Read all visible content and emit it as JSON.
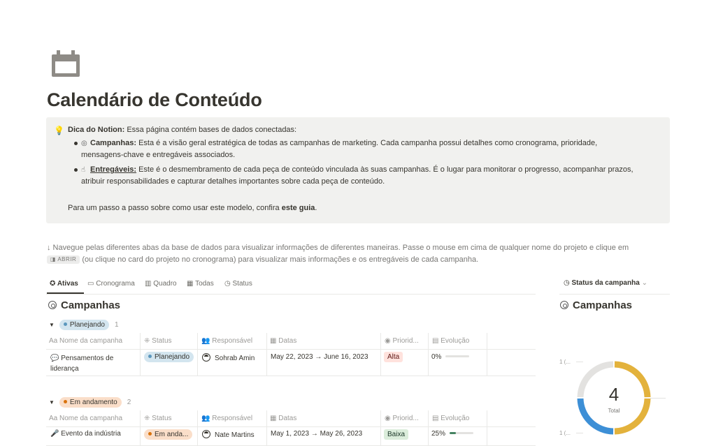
{
  "page": {
    "icon": "calendar-icon",
    "title": "Calendário de Conteúdo"
  },
  "callout": {
    "icon": "lightbulb-icon",
    "lead_bold": "Dica do Notion:",
    "lead_text": " Essa página contém bases de dados conectadas:",
    "items": [
      {
        "icon": "target-icon",
        "label": "Campanhas:",
        "line1": " Esta é a visão geral estratégica de todas as campanhas de marketing. Cada campanha possui detalhes como cronograma, prioridade,",
        "line2": "mensagens-chave e entregáveis associados."
      },
      {
        "icon": "hand-icon",
        "label": "Entregáveis:",
        "line1": " Este é o desmembramento de cada peça de conteúdo vinculada às suas campanhas. É o lugar para monitorar o progresso, acompanhar prazos,",
        "line2": "atribuir responsabilidades e capturar detalhes importantes sobre cada peça de conteúdo."
      }
    ],
    "guide_prefix": "Para um passo a passo sobre como usar este modelo, confira ",
    "guide_link": "este guia",
    "guide_suffix": "."
  },
  "instructions": {
    "line1": "↓ Navegue pelas diferentes abas da base de dados para visualizar informações de diferentes maneiras. Passe o mouse em cima de qualquer nome do projeto e clique em",
    "open_badge": "◨ ABRIR",
    "line2_rest": " (ou clique no card do projeto no cronograma) para visualizar mais informações e os entregáveis de cada campanha."
  },
  "tabs": [
    {
      "icon": "star-icon",
      "glyph": "✪",
      "label": "Ativas",
      "active": true
    },
    {
      "icon": "timeline-icon",
      "glyph": "▭",
      "label": "Cronograma",
      "active": false
    },
    {
      "icon": "board-icon",
      "glyph": "▥",
      "label": "Quadro",
      "active": false
    },
    {
      "icon": "table-icon",
      "glyph": "▦",
      "label": "Todas",
      "active": false
    },
    {
      "icon": "clock-icon",
      "glyph": "◷",
      "label": "Status",
      "active": false
    }
  ],
  "main_section_title": "Campanhas",
  "columns": [
    {
      "icon": "Aa",
      "label": "Nome da campanha"
    },
    {
      "icon": "⁜",
      "label": "Status"
    },
    {
      "icon": "👥",
      "label": "Responsável"
    },
    {
      "icon": "▦",
      "label": "Datas"
    },
    {
      "icon": "◉",
      "label": "Priorid..."
    },
    {
      "icon": "▤",
      "label": "Evolução"
    }
  ],
  "groups": [
    {
      "label": "Planejando",
      "count": "1",
      "rows": [
        {
          "icon": "speech-bubble-icon",
          "glyph": "💬",
          "name_line1": "Pensamentos de",
          "name_line2": "liderança",
          "status": "Planejando",
          "owner": "Sohrab Amin",
          "dates": "May 22, 2023 → June 16, 2023",
          "priority": "Alta",
          "progress_label": "0%",
          "progress": 0
        }
      ]
    },
    {
      "label": "Em andamento",
      "count": "2",
      "rows": [
        {
          "icon": "microphone-icon",
          "glyph": "🎤",
          "name_line1": "Evento da indústria",
          "name_line2": "",
          "status": "Em anda...",
          "owner": "Nate Martins",
          "dates": "May 1, 2023 → May 26, 2023",
          "priority": "Baixa",
          "progress_label": "25%",
          "progress": 0.25
        }
      ]
    }
  ],
  "sidebar": {
    "view_label": "Status da campanha",
    "view_chevron": "⌄",
    "title": "Campanhas",
    "chart_labels": [
      "1 (...",
      "1 (..."
    ]
  },
  "chart_data": {
    "type": "pie",
    "variant": "donut",
    "total": "4",
    "total_label": "Total",
    "slices": [
      {
        "value": 1,
        "color": "#e3b23c"
      },
      {
        "value": 1,
        "color": "#e3b23c"
      },
      {
        "value": 1,
        "color": "#3d8fd6"
      },
      {
        "value": 1,
        "color": "#e3e2e0"
      }
    ]
  },
  "colors": {
    "text": "#37352f",
    "muted": "#9b9a97",
    "callout_bg": "#f1f1ef",
    "status_blue": "#d3e5ef",
    "status_orange": "#fadec9",
    "priority_high": "#ffe2dd",
    "priority_low": "#dbeddb"
  }
}
